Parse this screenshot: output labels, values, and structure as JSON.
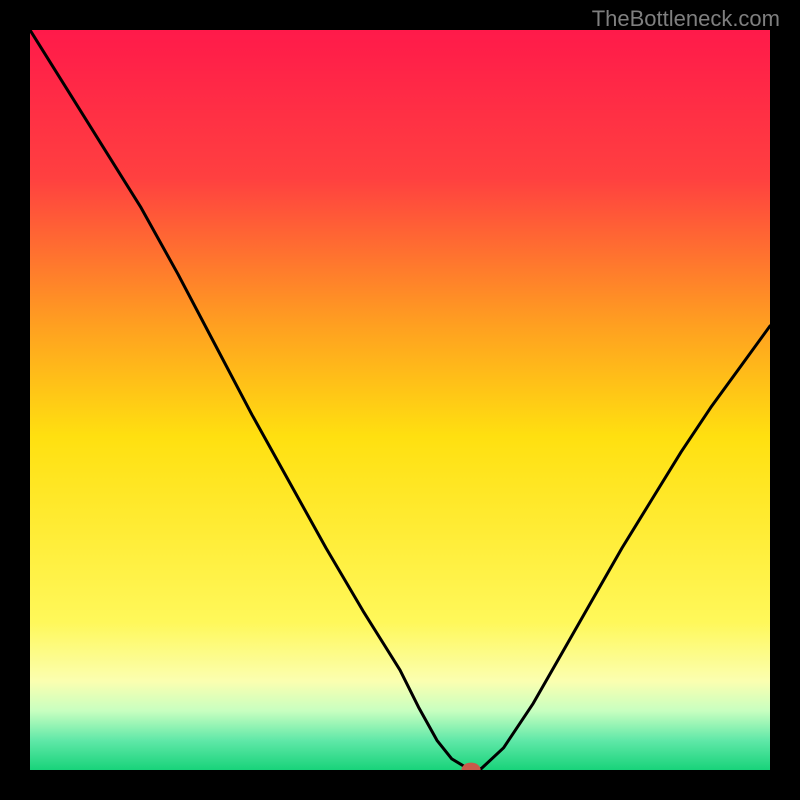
{
  "attribution": "TheBottleneck.com",
  "chart_data": {
    "type": "line",
    "title": "",
    "xlabel": "",
    "ylabel": "",
    "xlim": [
      0,
      1
    ],
    "ylim": [
      0,
      100
    ],
    "background_gradient": {
      "stops": [
        {
          "pos": 0.0,
          "color": "#ff1a4a"
        },
        {
          "pos": 0.2,
          "color": "#ff4040"
        },
        {
          "pos": 0.4,
          "color": "#ffa020"
        },
        {
          "pos": 0.55,
          "color": "#ffe010"
        },
        {
          "pos": 0.8,
          "color": "#fff85a"
        },
        {
          "pos": 0.88,
          "color": "#fbffb0"
        },
        {
          "pos": 0.92,
          "color": "#c8ffc0"
        },
        {
          "pos": 0.96,
          "color": "#60e8a8"
        },
        {
          "pos": 1.0,
          "color": "#18d37a"
        }
      ]
    },
    "series": [
      {
        "name": "curve",
        "color": "#000000",
        "x": [
          0.0,
          0.05,
          0.1,
          0.15,
          0.2,
          0.25,
          0.3,
          0.35,
          0.4,
          0.45,
          0.5,
          0.525,
          0.55,
          0.57,
          0.595,
          0.61,
          0.64,
          0.68,
          0.72,
          0.76,
          0.8,
          0.84,
          0.88,
          0.92,
          0.96,
          1.0
        ],
        "y": [
          100.0,
          92.0,
          84.0,
          76.0,
          67.0,
          57.5,
          48.0,
          39.0,
          30.0,
          21.5,
          13.5,
          8.5,
          4.0,
          1.5,
          0.0,
          0.2,
          3.0,
          9.0,
          16.0,
          23.0,
          30.0,
          36.5,
          43.0,
          49.0,
          54.5,
          60.0
        ]
      }
    ],
    "marker": {
      "name": "min-point",
      "x": 0.596,
      "y": 0.0,
      "rx": 0.013,
      "ry": 0.01,
      "color": "#c85a4a"
    }
  }
}
